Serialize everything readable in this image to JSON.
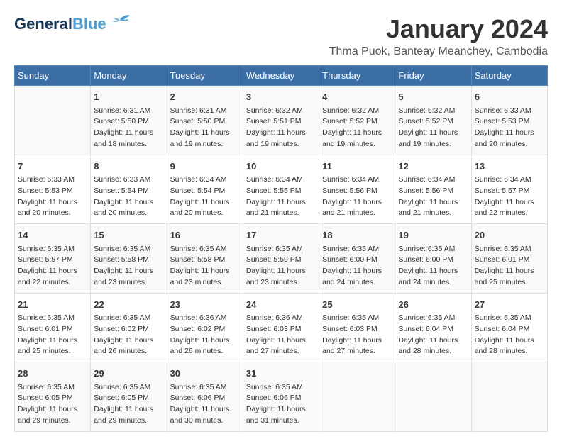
{
  "header": {
    "logo_general": "General",
    "logo_blue": "Blue",
    "month_year": "January 2024",
    "location": "Thma Puok, Banteay Meanchey, Cambodia"
  },
  "days_of_week": [
    "Sunday",
    "Monday",
    "Tuesday",
    "Wednesday",
    "Thursday",
    "Friday",
    "Saturday"
  ],
  "weeks": [
    [
      {
        "day": "",
        "info": ""
      },
      {
        "day": "1",
        "info": "Sunrise: 6:31 AM\nSunset: 5:50 PM\nDaylight: 11 hours\nand 18 minutes."
      },
      {
        "day": "2",
        "info": "Sunrise: 6:31 AM\nSunset: 5:50 PM\nDaylight: 11 hours\nand 19 minutes."
      },
      {
        "day": "3",
        "info": "Sunrise: 6:32 AM\nSunset: 5:51 PM\nDaylight: 11 hours\nand 19 minutes."
      },
      {
        "day": "4",
        "info": "Sunrise: 6:32 AM\nSunset: 5:52 PM\nDaylight: 11 hours\nand 19 minutes."
      },
      {
        "day": "5",
        "info": "Sunrise: 6:32 AM\nSunset: 5:52 PM\nDaylight: 11 hours\nand 19 minutes."
      },
      {
        "day": "6",
        "info": "Sunrise: 6:33 AM\nSunset: 5:53 PM\nDaylight: 11 hours\nand 20 minutes."
      }
    ],
    [
      {
        "day": "7",
        "info": "Sunrise: 6:33 AM\nSunset: 5:53 PM\nDaylight: 11 hours\nand 20 minutes."
      },
      {
        "day": "8",
        "info": "Sunrise: 6:33 AM\nSunset: 5:54 PM\nDaylight: 11 hours\nand 20 minutes."
      },
      {
        "day": "9",
        "info": "Sunrise: 6:34 AM\nSunset: 5:54 PM\nDaylight: 11 hours\nand 20 minutes."
      },
      {
        "day": "10",
        "info": "Sunrise: 6:34 AM\nSunset: 5:55 PM\nDaylight: 11 hours\nand 21 minutes."
      },
      {
        "day": "11",
        "info": "Sunrise: 6:34 AM\nSunset: 5:56 PM\nDaylight: 11 hours\nand 21 minutes."
      },
      {
        "day": "12",
        "info": "Sunrise: 6:34 AM\nSunset: 5:56 PM\nDaylight: 11 hours\nand 21 minutes."
      },
      {
        "day": "13",
        "info": "Sunrise: 6:34 AM\nSunset: 5:57 PM\nDaylight: 11 hours\nand 22 minutes."
      }
    ],
    [
      {
        "day": "14",
        "info": "Sunrise: 6:35 AM\nSunset: 5:57 PM\nDaylight: 11 hours\nand 22 minutes."
      },
      {
        "day": "15",
        "info": "Sunrise: 6:35 AM\nSunset: 5:58 PM\nDaylight: 11 hours\nand 23 minutes."
      },
      {
        "day": "16",
        "info": "Sunrise: 6:35 AM\nSunset: 5:58 PM\nDaylight: 11 hours\nand 23 minutes."
      },
      {
        "day": "17",
        "info": "Sunrise: 6:35 AM\nSunset: 5:59 PM\nDaylight: 11 hours\nand 23 minutes."
      },
      {
        "day": "18",
        "info": "Sunrise: 6:35 AM\nSunset: 6:00 PM\nDaylight: 11 hours\nand 24 minutes."
      },
      {
        "day": "19",
        "info": "Sunrise: 6:35 AM\nSunset: 6:00 PM\nDaylight: 11 hours\nand 24 minutes."
      },
      {
        "day": "20",
        "info": "Sunrise: 6:35 AM\nSunset: 6:01 PM\nDaylight: 11 hours\nand 25 minutes."
      }
    ],
    [
      {
        "day": "21",
        "info": "Sunrise: 6:35 AM\nSunset: 6:01 PM\nDaylight: 11 hours\nand 25 minutes."
      },
      {
        "day": "22",
        "info": "Sunrise: 6:35 AM\nSunset: 6:02 PM\nDaylight: 11 hours\nand 26 minutes."
      },
      {
        "day": "23",
        "info": "Sunrise: 6:36 AM\nSunset: 6:02 PM\nDaylight: 11 hours\nand 26 minutes."
      },
      {
        "day": "24",
        "info": "Sunrise: 6:36 AM\nSunset: 6:03 PM\nDaylight: 11 hours\nand 27 minutes."
      },
      {
        "day": "25",
        "info": "Sunrise: 6:35 AM\nSunset: 6:03 PM\nDaylight: 11 hours\nand 27 minutes."
      },
      {
        "day": "26",
        "info": "Sunrise: 6:35 AM\nSunset: 6:04 PM\nDaylight: 11 hours\nand 28 minutes."
      },
      {
        "day": "27",
        "info": "Sunrise: 6:35 AM\nSunset: 6:04 PM\nDaylight: 11 hours\nand 28 minutes."
      }
    ],
    [
      {
        "day": "28",
        "info": "Sunrise: 6:35 AM\nSunset: 6:05 PM\nDaylight: 11 hours\nand 29 minutes."
      },
      {
        "day": "29",
        "info": "Sunrise: 6:35 AM\nSunset: 6:05 PM\nDaylight: 11 hours\nand 29 minutes."
      },
      {
        "day": "30",
        "info": "Sunrise: 6:35 AM\nSunset: 6:06 PM\nDaylight: 11 hours\nand 30 minutes."
      },
      {
        "day": "31",
        "info": "Sunrise: 6:35 AM\nSunset: 6:06 PM\nDaylight: 11 hours\nand 31 minutes."
      },
      {
        "day": "",
        "info": ""
      },
      {
        "day": "",
        "info": ""
      },
      {
        "day": "",
        "info": ""
      }
    ]
  ]
}
